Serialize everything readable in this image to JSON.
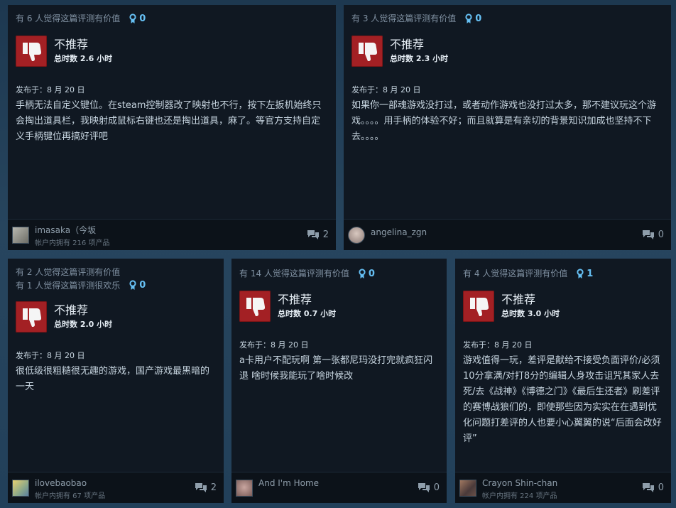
{
  "colors": {
    "accent": "#66c0f4",
    "negative": "#a32024",
    "card": "#101822"
  },
  "reviews": [
    {
      "helpful_lines": [
        "有 6 人觉得这篇评测有价值"
      ],
      "awards": "0",
      "verdict": "不推荐",
      "hours": "总时数 2.6 小时",
      "posted": "发布于：8 月 20 日",
      "text": "手柄无法自定义键位。在steam控制器改了映射也不行，按下左扳机始终只会掏出道具栏，我映射成鼠标右键也还是掏出道具，麻了。等官方支持自定义手柄键位再搞好评吧",
      "username": "imasaka（今坂",
      "products": "帐户内拥有 216 项产品",
      "comments": "2"
    },
    {
      "helpful_lines": [
        "有 3 人觉得这篇评测有价值"
      ],
      "awards": "0",
      "verdict": "不推荐",
      "hours": "总时数 2.3 小时",
      "posted": "发布于：8 月 20 日",
      "text": "如果你一部魂游戏没打过，或者动作游戏也没打过太多，那不建议玩这个游戏。。。。用手柄的体验不好；而且就算是有亲切的背景知识加成也坚持不下去。。。。",
      "username": "angelina_zgn",
      "products": "",
      "comments": "0"
    },
    {
      "helpful_lines": [
        "有 2 人觉得这篇评测有价值",
        "有 1 人觉得这篇评测很欢乐"
      ],
      "awards": "0",
      "verdict": "不推荐",
      "hours": "总时数 2.0 小时",
      "posted": "发布于：8 月 20 日",
      "text": "很低级很粗糙很无趣的游戏，国产游戏最黑暗的一天",
      "username": "ilovebaobao",
      "products": "帐户内拥有 67 项产品",
      "comments": "2"
    },
    {
      "helpful_lines": [
        "有 14 人觉得这篇评测有价值"
      ],
      "awards": "0",
      "verdict": "不推荐",
      "hours": "总时数 0.7 小时",
      "posted": "发布于：8 月 20 日",
      "text": "a卡用户不配玩啊 第一张都尼玛没打完就疯狂闪退 啥时候我能玩了啥时候改",
      "username": "And I'm Home",
      "products": "",
      "comments": "0"
    },
    {
      "helpful_lines": [
        "有 4 人觉得这篇评测有价值"
      ],
      "awards": "1",
      "verdict": "不推荐",
      "hours": "总时数 3.0 小时",
      "posted": "发布于：8 月 20 日",
      "text": "游戏值得一玩，差评是献给不接受负面评价/必须10分拿满/对打8分的编辑人身攻击诅咒其家人去死/去《战神》《博德之门》《最后生还者》刷差评的赛博战狼们的，即使那些因为实实在在遇到优化问题打差评的人也要小心翼翼的说“后面会改好评”",
      "username": "Crayon Shin-chan",
      "products": "帐户内拥有 224 项产品",
      "comments": "0"
    }
  ]
}
